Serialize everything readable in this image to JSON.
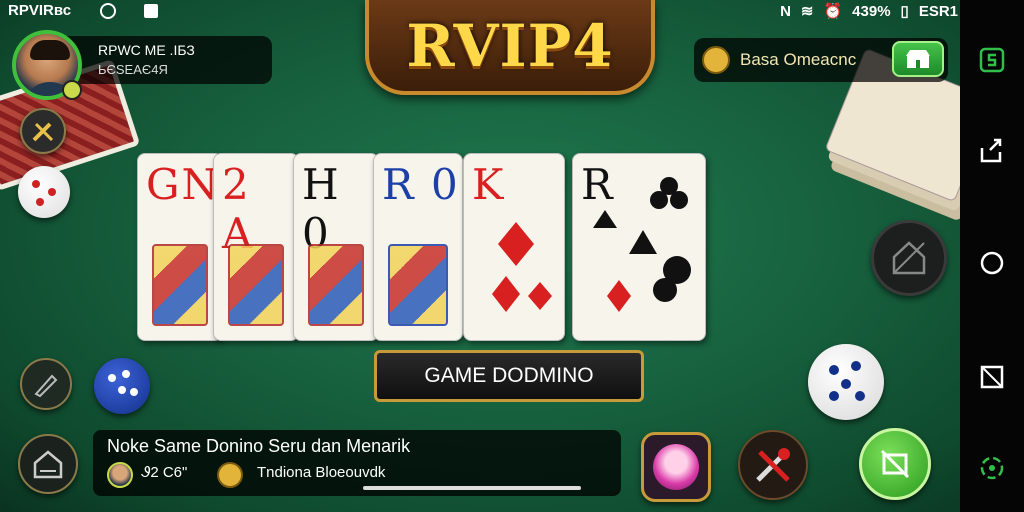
{
  "status_bar": {
    "left_text": "RPVIRвс",
    "battery": "439%",
    "time": "ESR1"
  },
  "logo": {
    "title": "RVIP4"
  },
  "player": {
    "name": "RPWC ME .ІБЗ",
    "id": "ЬЄSEAЄ4Я"
  },
  "currency": {
    "label": "Basa  Omeacnc"
  },
  "cards": [
    {
      "rank": "GN",
      "color": "red"
    },
    {
      "rank": "2 A",
      "color": "red"
    },
    {
      "rank": "H 0",
      "color": "black"
    },
    {
      "rank": "R 0",
      "color": "blue"
    },
    {
      "rank": "K",
      "color": "red"
    },
    {
      "rank": "R",
      "color": "black"
    }
  ],
  "game_banner": {
    "label": "GAME DODMINO"
  },
  "chat": {
    "title": "Noke Same Donino Seru dan Menarik",
    "stat": "Ꮽ2  C6\"",
    "sub": "Tndiona  Bloeouvdk"
  },
  "colors": {
    "felt": "#17613e",
    "accent_green": "#3fbf3a",
    "gold": "#ffd84a"
  }
}
